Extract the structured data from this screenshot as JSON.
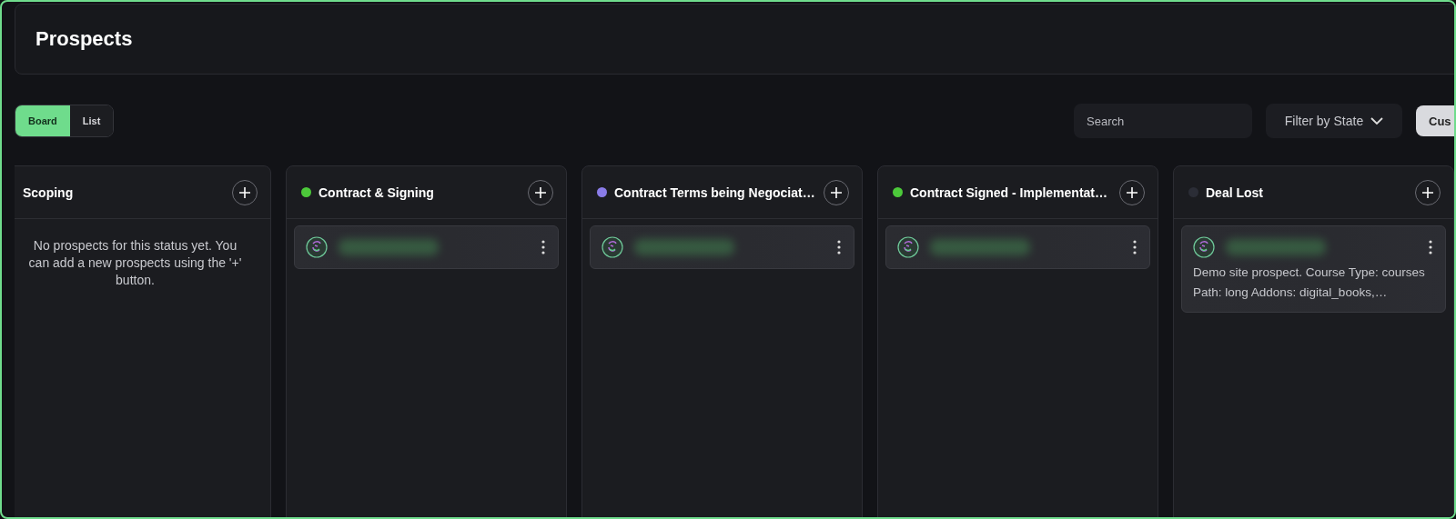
{
  "header": {
    "title": "Prospects"
  },
  "view_toggle": [
    {
      "label": "Board",
      "selected": true
    },
    {
      "label": "List",
      "selected": false
    }
  ],
  "search": {
    "placeholder": "Search"
  },
  "filter": {
    "label": "Filter by State"
  },
  "action_button": {
    "label": "Cus"
  },
  "columns": [
    {
      "title": "Scoping",
      "empty_message": "No prospects for this status yet. You can add a new prospects using the '+' button."
    },
    {
      "title": "Contract & Signing",
      "color": "#4cc93a",
      "cards": [
        {
          "kind": "prospect"
        }
      ]
    },
    {
      "title": "Contract Terms being Negociat…",
      "color": "#8a7ce8",
      "cards": [
        {
          "kind": "prospect"
        }
      ]
    },
    {
      "title": "Contract Signed - Implementat…",
      "color": "#4cc93a",
      "cards": [
        {
          "kind": "prospect"
        }
      ]
    },
    {
      "title": "Deal Lost",
      "color": "#2b2d36",
      "cards": [
        {
          "kind": "prospect",
          "description": "Demo site prospect. Course Type: courses Path: long Addons: digital_books,…"
        }
      ]
    }
  ]
}
